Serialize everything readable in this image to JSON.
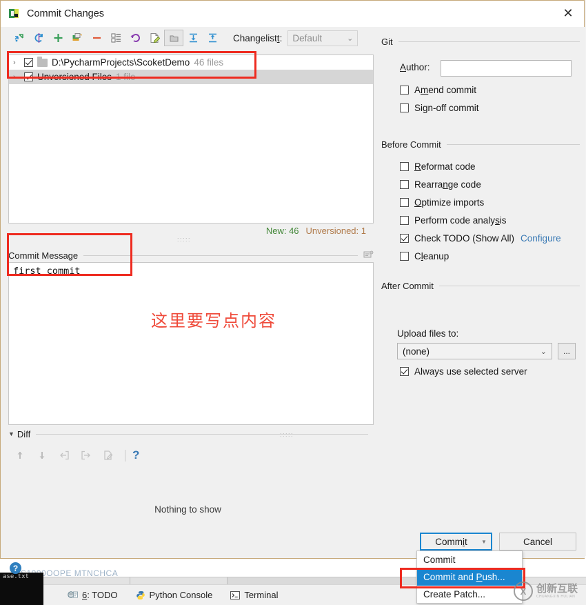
{
  "window": {
    "title": "Commit Changes",
    "icon": "commit-changes-icon",
    "close_label": "✕"
  },
  "toolbar": {
    "changelist_label_pre": "Changelist",
    "changelist_label_mnemonic": "t",
    "changelist_label_post": ":",
    "changelist_value": "Default",
    "chevron": "⌄",
    "buttons": [
      {
        "name": "show-diff-icon",
        "tip": "Show Diff"
      },
      {
        "name": "refresh-icon",
        "tip": "Refresh Changes"
      },
      {
        "name": "add-changelist-icon",
        "tip": "New Changelist"
      },
      {
        "name": "move-to-changelist-icon",
        "tip": "Move to Another Changelist"
      },
      {
        "name": "delete-changelist-icon",
        "tip": "Delete Changelist"
      },
      {
        "name": "set-active-changelist-icon",
        "tip": "Set Active Changelist"
      },
      {
        "name": "rollback-icon",
        "tip": "Rollback"
      },
      {
        "name": "edit-source-icon",
        "tip": "Edit Source"
      },
      {
        "name": "group-by-directory-icon",
        "tip": "Group by Directory"
      },
      {
        "name": "expand-all-icon",
        "tip": "Expand All"
      },
      {
        "name": "collapse-all-icon",
        "tip": "Collapse All"
      }
    ]
  },
  "tree": {
    "rows": [
      {
        "name": "tree-row-project",
        "expand_chevron": "›",
        "checked": true,
        "has_folder_icon": true,
        "label": "D:\\PycharmProjects\\ScoketDemo",
        "count": "46 files",
        "selected": false
      },
      {
        "name": "tree-row-unversioned",
        "expand_chevron": "›",
        "checked": true,
        "has_folder_icon": false,
        "label": "Unversioned Files",
        "count": "1 file",
        "selected": true
      }
    ]
  },
  "counts": {
    "new": "New: 46",
    "unversioned": "Unversioned: 1",
    "new_color": "#44883a",
    "unversioned_color": "#b07a4a"
  },
  "commit_message": {
    "header": "Commit Message",
    "value": "first commit",
    "history_icon": "message-history-icon"
  },
  "annotation": {
    "note_cn": "这里要写点内容",
    "note_color": "#ef4a3a"
  },
  "diff": {
    "header": "Diff",
    "caret": "▼",
    "empty_text": "Nothing to show",
    "buttons": [
      {
        "name": "previous-difference-icon"
      },
      {
        "name": "next-difference-icon"
      },
      {
        "name": "accept-left-icon"
      },
      {
        "name": "accept-right-icon"
      },
      {
        "name": "edit-diff-icon"
      }
    ],
    "help_glyph": "?"
  },
  "help": {
    "glyph": "?"
  },
  "git_panel": {
    "group_title": "Git",
    "author_label_pre": "",
    "author_label_mnemonic": "A",
    "author_label_post": "uthor:",
    "author_value": "",
    "author_placeholder": "",
    "checkboxes": [
      {
        "name": "amend-commit-checkbox",
        "pre": "A",
        "mnemonic": "m",
        "post": "end commit",
        "checked": false
      },
      {
        "name": "sign-off-commit-checkbox",
        "pre": "Si",
        "mnemonic": "g",
        "post": "n-off commit",
        "checked": false
      }
    ]
  },
  "before_commit": {
    "group_title": "Before Commit",
    "checkboxes": [
      {
        "name": "reformat-code-checkbox",
        "pre": "",
        "mnemonic": "R",
        "post": "eformat code",
        "checked": false
      },
      {
        "name": "rearrange-code-checkbox",
        "pre": "Rearra",
        "mnemonic": "n",
        "post": "ge code",
        "checked": false
      },
      {
        "name": "optimize-imports-checkbox",
        "pre": "",
        "mnemonic": "O",
        "post": "ptimize imports",
        "checked": false
      },
      {
        "name": "perform-code-analysis-checkbox",
        "pre": "Perform code analy",
        "mnemonic": "s",
        "post": "is",
        "checked": false
      },
      {
        "name": "check-todo-checkbox",
        "pre": "Check TODO (Show All)",
        "mnemonic": "",
        "post": "",
        "checked": true
      },
      {
        "name": "cleanup-checkbox",
        "pre": "C",
        "mnemonic": "l",
        "post": "eanup",
        "checked": false
      }
    ],
    "configure_link": "Configure",
    "configure_link_color": "#3a7ab5"
  },
  "after_commit": {
    "group_title": "After Commit",
    "upload_label": "Upload files to:",
    "upload_value": "(none)",
    "upload_chevron": "⌄",
    "more_button": "...",
    "always_use_server": {
      "label": "Always use selected server",
      "checked": true
    }
  },
  "buttons": {
    "commit_pre": "Comm",
    "commit_mnemonic": "i",
    "commit_post": "t",
    "commit_arrow": "▼",
    "cancel": "Cancel"
  },
  "menu": {
    "items": [
      {
        "name": "menu-item-commit",
        "pre": "Commit",
        "mnemonic": "",
        "post": "",
        "highlighted": false
      },
      {
        "name": "menu-item-commit-and-push",
        "pre": "Commit and ",
        "mnemonic": "P",
        "post": "ush...",
        "highlighted": true
      },
      {
        "name": "menu-item-create-patch",
        "pre": "Create Patch...",
        "mnemonic": "",
        "post": "",
        "highlighted": false
      }
    ],
    "highlight_color": "#1a86d0"
  },
  "ide_background": {
    "ghost_text": "S1000OOPE  MTNCHCA",
    "black_label": "ase.txt",
    "tool_windows": [
      {
        "name": "tool-window-todo",
        "pre": "",
        "mnemonic": "6",
        "post": ": TODO",
        "icon": "todo-icon"
      },
      {
        "name": "tool-window-python-console",
        "pre": "Python Console",
        "mnemonic": "",
        "post": "",
        "icon": "python-icon"
      },
      {
        "name": "tool-window-terminal",
        "pre": "Terminal",
        "mnemonic": "",
        "post": "",
        "icon": "terminal-icon"
      }
    ]
  },
  "watermark": {
    "logo": "X",
    "cn": "创新互联",
    "en": "CHUANGXIN HULIAN"
  }
}
